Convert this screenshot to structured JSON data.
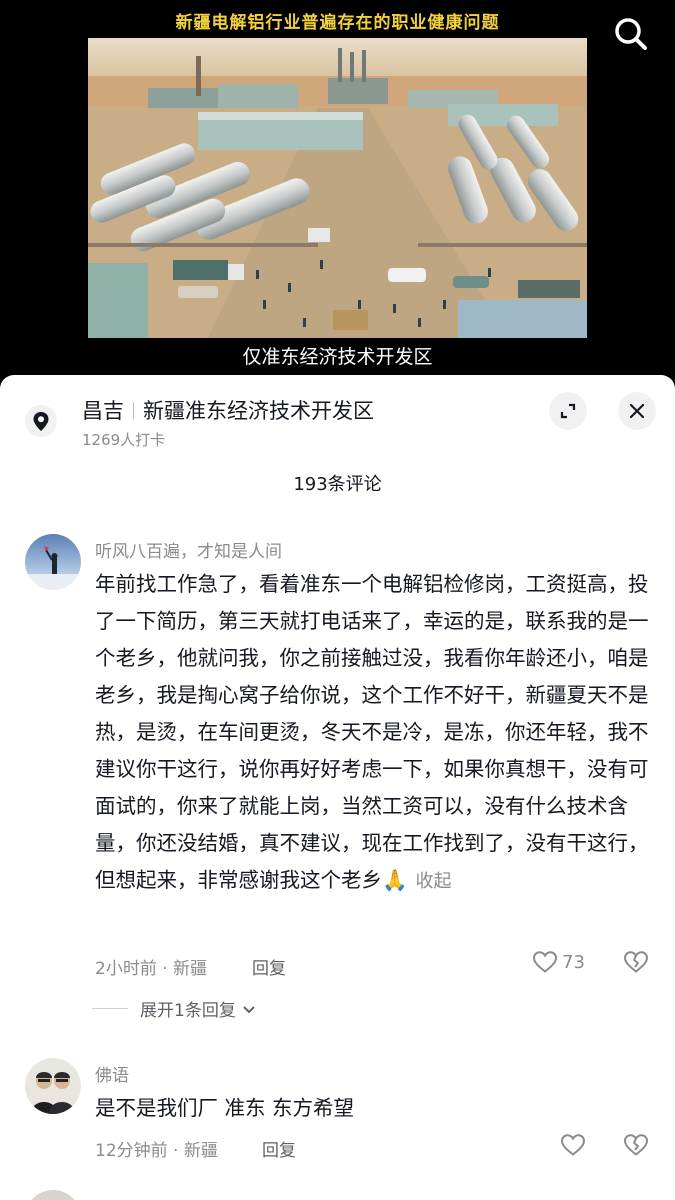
{
  "video": {
    "title": "新疆电解铝行业普遍存在的职业健康问题",
    "subtitle": "仅准东经济技术开发区",
    "search_icon": "search-icon",
    "image": "aerial-industrial-plant"
  },
  "location": {
    "icon": "location-pin-icon",
    "city": "昌吉",
    "place": "新疆准东经济技术开发区",
    "checkins": "1269人打卡"
  },
  "sheet": {
    "comment_count": "193条评论"
  },
  "comments": [
    {
      "username": "听风八百遍，才知是人间",
      "text": "年前找工作急了，看着准东一个电解铝检修岗，工资挺高，投了一下简历，第三天就打电话来了，幸运的是，联系我的是一个老乡，他就问我，你之前接触过没，我看你年龄还小，咱是老乡，我是掏心窝子给你说，这个工作不好干，新疆夏天不是热，是烫，在车间更烫，冬天不是冷，是冻，你还年轻，我不建议你干这行，说你再好好考虑一下，如果你真想干，没有可面试的，你来了就能上岗，当然工资可以，没有什么技术含量，你还没结婚，真不建议，现在工作找到了，没有干这行，但想起来，非常感谢我这个老乡🙏",
      "collapse": "收起",
      "meta": "2小时前 · 新疆",
      "reply": "回复",
      "likes": "73",
      "expand": "展开1条回复"
    },
    {
      "username": "佛语",
      "text": "是不是我们厂 准东 东方希望",
      "meta": "12分钟前 · 新疆",
      "reply": "回复"
    }
  ]
}
